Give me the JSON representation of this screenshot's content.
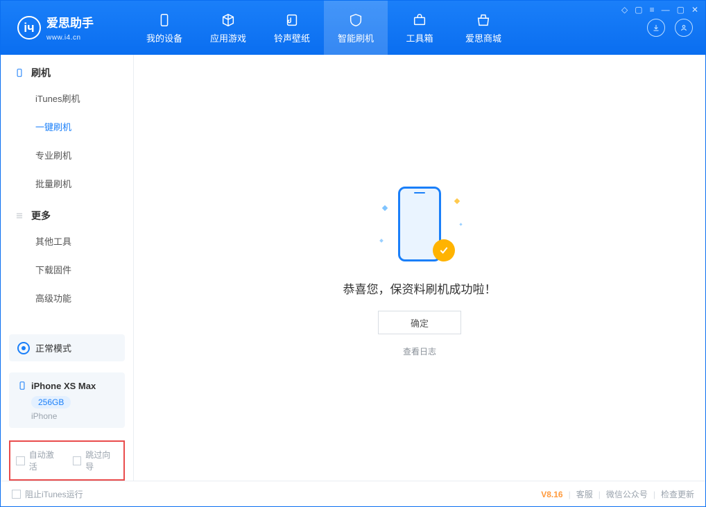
{
  "app": {
    "name_cn": "爱思助手",
    "url": "www.i4.cn"
  },
  "nav": {
    "tabs": [
      {
        "label": "我的设备"
      },
      {
        "label": "应用游戏"
      },
      {
        "label": "铃声壁纸"
      },
      {
        "label": "智能刷机"
      },
      {
        "label": "工具箱"
      },
      {
        "label": "爱思商城"
      }
    ]
  },
  "sidebar": {
    "sec1_title": "刷机",
    "sec1_items": [
      {
        "label": "iTunes刷机"
      },
      {
        "label": "一键刷机"
      },
      {
        "label": "专业刷机"
      },
      {
        "label": "批量刷机"
      }
    ],
    "sec2_title": "更多",
    "sec2_items": [
      {
        "label": "其他工具"
      },
      {
        "label": "下载固件"
      },
      {
        "label": "高级功能"
      }
    ],
    "mode_label": "正常模式",
    "device": {
      "name": "iPhone XS Max",
      "capacity": "256GB",
      "sub": "iPhone"
    },
    "chk_auto_activate": "自动激活",
    "chk_skip_guide": "跳过向导"
  },
  "main": {
    "success_msg": "恭喜您，保资料刷机成功啦！",
    "ok_label": "确定",
    "log_link": "查看日志"
  },
  "footer": {
    "block_itunes": "阻止iTunes运行",
    "version": "V8.16",
    "links": {
      "kf": "客服",
      "wx": "微信公众号",
      "upd": "检查更新"
    }
  }
}
